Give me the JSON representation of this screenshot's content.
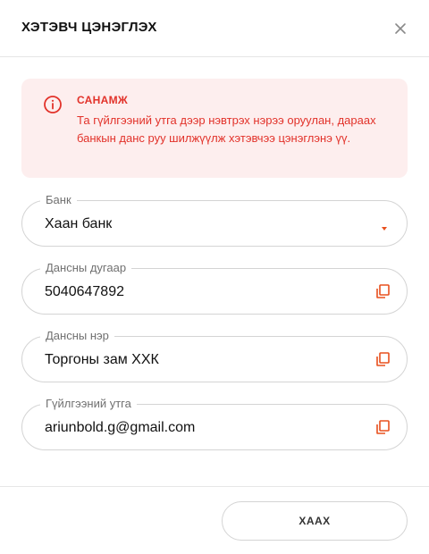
{
  "modal": {
    "title": "ХЭТЭВЧ ЦЭНЭГЛЭХ",
    "close_icon": "close-icon"
  },
  "alert": {
    "icon": "info-circle-icon",
    "title": "САНАМЖ",
    "text": "Та гүйлгээний утга дээр нэвтрэх нэрээ оруулан, дараах банкын данс руу шилжүүлж хэтэвчээ цэнэглэнэ үү.",
    "color": "#e2322a",
    "background": "#fdeeee"
  },
  "fields": {
    "bank": {
      "label": "Банк",
      "value": "Хаан банк",
      "icon": "dropdown-caret-icon"
    },
    "account_number": {
      "label": "Дансны дугаар",
      "value": "5040647892",
      "icon": "copy-icon"
    },
    "account_name": {
      "label": "Дансны нэр",
      "value": "Торгоны зам ХХК",
      "icon": "copy-icon"
    },
    "transaction_note": {
      "label": "Гүйлгээний утга",
      "value": "ariunbold.g@gmail.com",
      "icon": "copy-icon"
    }
  },
  "footer": {
    "close_label": "ХААХ"
  },
  "colors": {
    "accent": "#e8501e",
    "border": "#d4d4d4"
  }
}
